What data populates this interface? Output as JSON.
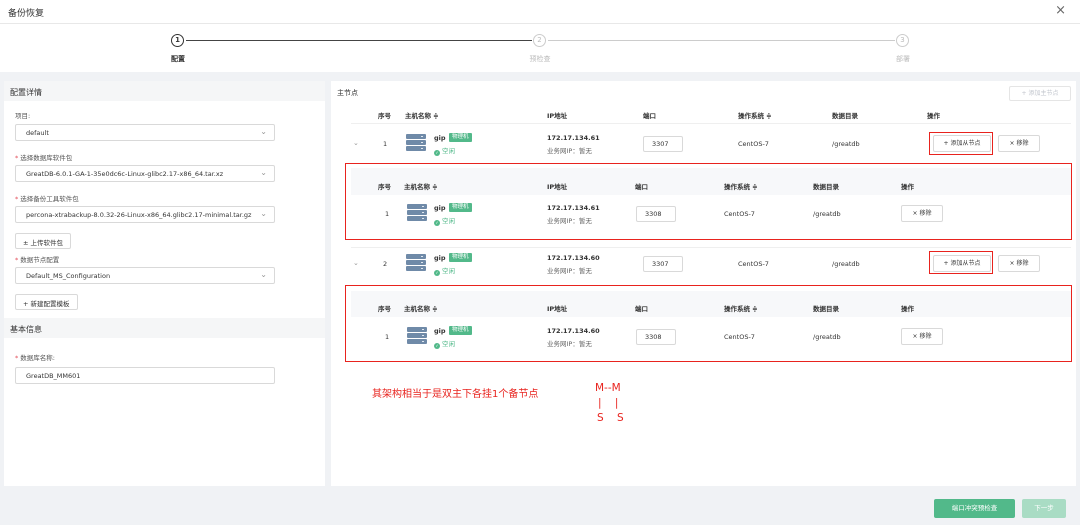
{
  "window": {
    "title": "备份恢复",
    "close_glyph": "×"
  },
  "steps": [
    {
      "num": "1",
      "label": "配置",
      "active": true
    },
    {
      "num": "2",
      "label": "预检查",
      "active": false
    },
    {
      "num": "3",
      "label": "部署",
      "active": false
    }
  ],
  "config": {
    "section_title": "配置详情",
    "project_label": "项目:",
    "project_value": "default",
    "db_pkg_label": "选择数据库软件包",
    "db_pkg_value": "GreatDB-6.0.1-GA-1-35e0dc6c-Linux-glibc2.17-x86_64.tar.xz",
    "backup_pkg_label": "选择备份工具软件包",
    "backup_pkg_value": "percona-xtrabackup-8.0.32-26-Linux-x86_64.glibc2.17-minimal.tar.gz",
    "upload_label": "± 上传软件包",
    "node_cfg_label": "数据节点配置",
    "node_cfg_value": "Default_MS_Configuration",
    "new_template_label": "+ 新建配置模板"
  },
  "basic": {
    "section_title": "基本信息",
    "db_name_label": "数据库名称:",
    "db_name_value": "GreatDB_MM601"
  },
  "master": {
    "section_title": "主节点",
    "add_master_label": "+ 添加主节点",
    "headers": {
      "seq": "序号",
      "host": "主机名称 ≑",
      "ip": "IP地址",
      "port": "端口",
      "os": "操作系统 ≑",
      "datadir": "数据目录",
      "ops": "操作"
    },
    "rows": [
      {
        "seq": "1",
        "host": "gip",
        "tag": "物理机",
        "status": "空闲",
        "ip": "172.17.134.61",
        "net": "业务网IP：暂无",
        "port": "3307",
        "os": "CentOS-7",
        "datadir": "/greatdb",
        "add_slave": "+ 添加从节点",
        "remove": "× 移除",
        "slave": {
          "seq": "1",
          "host": "gip",
          "tag": "物理机",
          "status": "空闲",
          "ip": "172.17.134.61",
          "net": "业务网IP：暂无",
          "port": "3308",
          "os": "CentOS-7",
          "datadir": "/greatdb",
          "remove": "× 移除"
        }
      },
      {
        "seq": "2",
        "host": "gip",
        "tag": "物理机",
        "status": "空闲",
        "ip": "172.17.134.60",
        "net": "业务网IP：暂无",
        "port": "3307",
        "os": "CentOS-7",
        "datadir": "/greatdb",
        "add_slave": "+ 添加从节点",
        "remove": "× 移除",
        "slave": {
          "seq": "1",
          "host": "gip",
          "tag": "物理机",
          "status": "空闲",
          "ip": "172.17.134.60",
          "net": "业务网IP：暂无",
          "port": "3308",
          "os": "CentOS-7",
          "datadir": "/greatdb",
          "remove": "× 移除"
        }
      }
    ]
  },
  "annotation": {
    "note": "其架构相当于是双主下各挂1个备节点",
    "line1": "M--M",
    "line2": "|    |",
    "line3": "S    S"
  },
  "footer": {
    "precheck": "端口冲突预检查",
    "next": "下一步"
  },
  "colors": {
    "accent": "#52b98a",
    "annotation_red": "#e8231e"
  }
}
